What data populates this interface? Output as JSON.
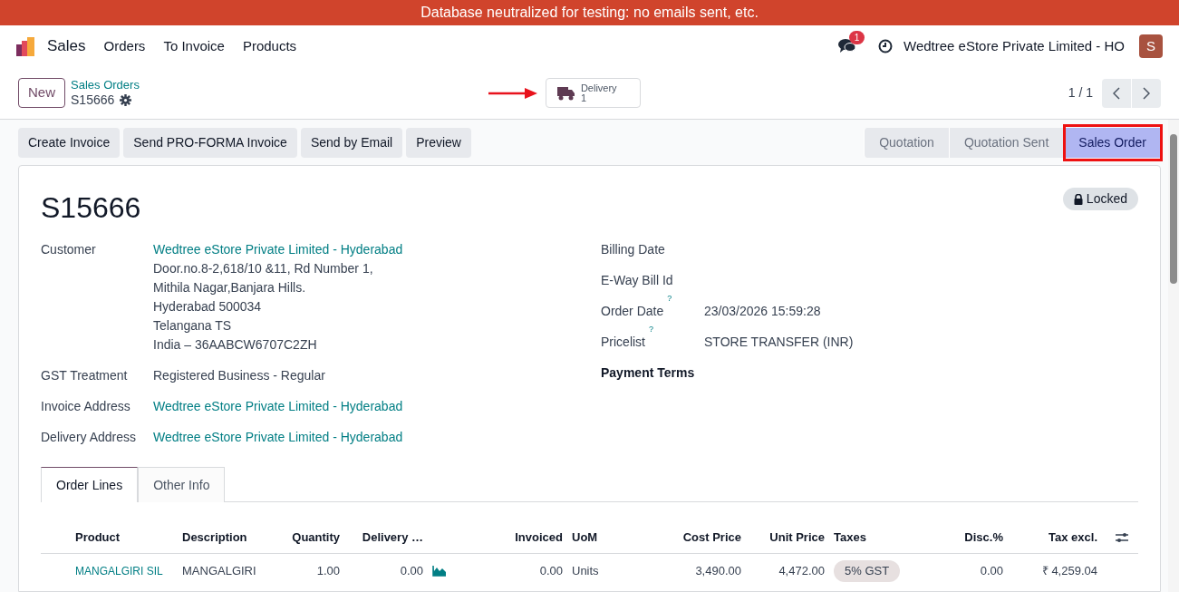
{
  "banner": "Database neutralized for testing: no emails sent, etc.",
  "navbar": {
    "app": "Sales",
    "menu": [
      "Orders",
      "To Invoice",
      "Products"
    ],
    "messages_badge": "1",
    "company": "Wedtree eStore Private Limited - HO",
    "avatar": "S"
  },
  "control_panel": {
    "new_button": "New",
    "breadcrumb": "Sales Orders",
    "record": "S15666",
    "smart_button": {
      "label": "Delivery",
      "count": "1"
    },
    "pager": "1 / 1"
  },
  "actions": [
    "Create Invoice",
    "Send PRO-FORMA Invoice",
    "Send by Email",
    "Preview"
  ],
  "stages": [
    {
      "label": "Quotation",
      "selected": false
    },
    {
      "label": "Quotation Sent",
      "selected": false
    },
    {
      "label": "Sales Order",
      "selected": true
    }
  ],
  "title": "S15666",
  "badge": "Locked",
  "left_fields": [
    {
      "label": "Customer",
      "kind": "link",
      "value": "Wedtree eStore Private Limited - Hyderabad",
      "lines": [
        "Door.no.8-2,618/10 &11, Rd Number 1,",
        "Mithila Nagar,Banjara Hills.",
        "Hyderabad 500034",
        "Telangana TS",
        "India – 36AABCW6707C2ZH"
      ]
    },
    {
      "label": "GST Treatment",
      "kind": "text",
      "value": "Registered Business - Regular"
    },
    {
      "label": "Invoice Address",
      "kind": "link",
      "value": "Wedtree eStore Private Limited - Hyderabad"
    },
    {
      "label": "Delivery Address",
      "kind": "link",
      "value": "Wedtree eStore Private Limited - Hyderabad"
    }
  ],
  "right_fields": [
    {
      "label": "Billing Date",
      "bold": false
    },
    {
      "label": "E-Way Bill Id",
      "bold": false
    },
    {
      "label": "Order Date",
      "help": "?",
      "value": "23/03/2026 15:59:28",
      "bold": false
    },
    {
      "label": "Pricelist",
      "help": "?",
      "value": "STORE TRANSFER (INR)",
      "bold": false
    },
    {
      "label": "Payment Terms",
      "bold": true
    }
  ],
  "tabs": [
    {
      "label": "Order Lines",
      "selected": true
    },
    {
      "label": "Other Info",
      "selected": false
    }
  ],
  "table": {
    "columns": [
      {
        "label": "Product",
        "numeric": false
      },
      {
        "label": "Description",
        "numeric": false
      },
      {
        "label": "Quantity",
        "numeric": true
      },
      {
        "label": "Delivery …",
        "numeric": true
      },
      {
        "label": "Invoiced",
        "numeric": true
      },
      {
        "label": "UoM",
        "numeric": false
      },
      {
        "label": "Cost Price",
        "numeric": true
      },
      {
        "label": "Unit Price",
        "numeric": true
      },
      {
        "label": "Taxes",
        "numeric": false
      },
      {
        "label": "Disc.%",
        "numeric": true
      },
      {
        "label": "Tax excl.",
        "numeric": true
      }
    ],
    "rows": [
      {
        "cells": [
          {
            "kind": "link",
            "text": "MANGALGIRI SIL"
          },
          {
            "kind": "text",
            "text": "MANGALGIRI"
          },
          {
            "kind": "text",
            "text": "1.00"
          },
          {
            "kind": "forecast",
            "text": "0.00"
          },
          {
            "kind": "text",
            "text": "0.00"
          },
          {
            "kind": "text",
            "text": "Units"
          },
          {
            "kind": "text",
            "text": "3,490.00"
          },
          {
            "kind": "text",
            "text": "4,472.00"
          },
          {
            "kind": "badge",
            "text": "5% GST"
          },
          {
            "kind": "text",
            "text": "0.00"
          },
          {
            "kind": "text",
            "text": "₹ 4,259.04"
          }
        ]
      }
    ]
  }
}
